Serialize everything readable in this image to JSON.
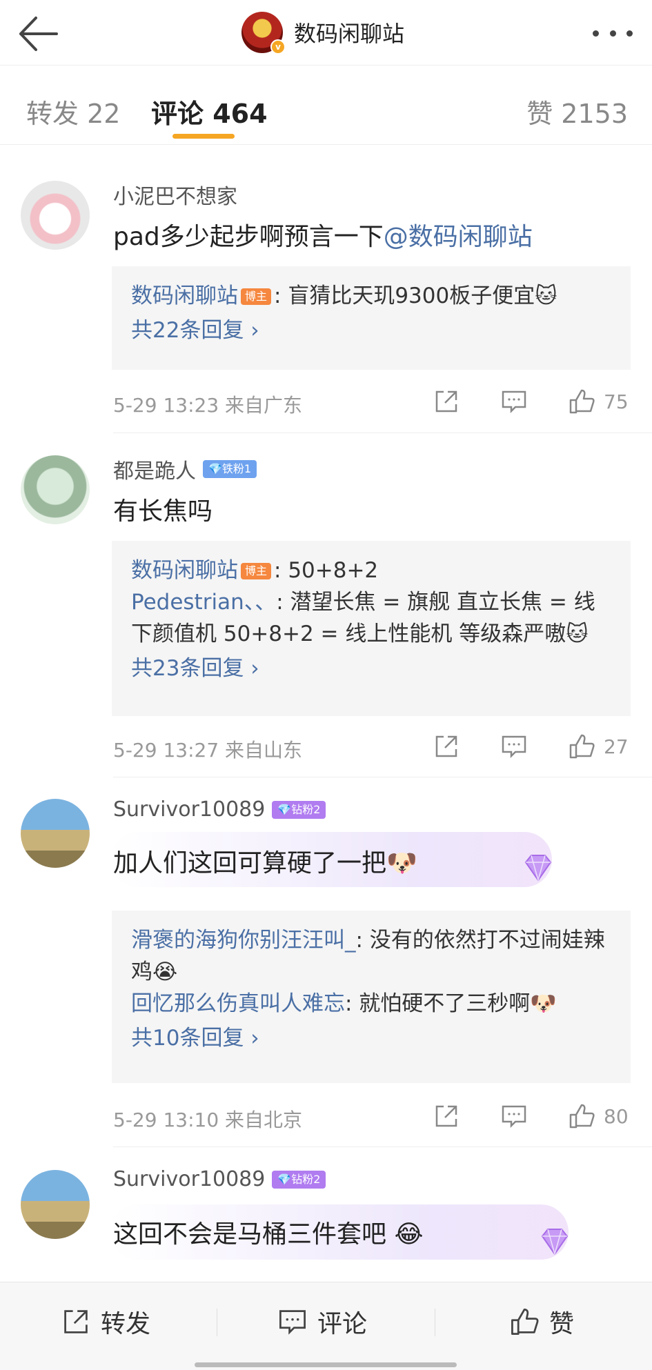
{
  "header": {
    "title": "数码闲聊站"
  },
  "tabs": {
    "repost": "转发 22",
    "comments": "评论 464",
    "likes": "赞 2153"
  },
  "comments": [
    {
      "username": "小泥巴不想家",
      "text": "pad多少起步啊预言一下",
      "mention": "@数码闲聊站",
      "replies": [
        {
          "name": "数码闲聊站",
          "badge": "博主",
          "text": ": 盲猜比天玑9300板子便宜🐱"
        }
      ],
      "more_replies": "共22条回复 ›",
      "time_location": "5-29 13:23  来自广东",
      "likes": "75"
    },
    {
      "username": "都是跪人",
      "badge": "💎铁粉1",
      "text": "有长焦吗",
      "replies": [
        {
          "name": "数码闲聊站",
          "badge": "博主",
          "text": ": 50+8+2"
        },
        {
          "name": "Pedestrian、、",
          "text": ": 潜望长焦 = 旗舰 直立长焦 = 线下颜值机 50+8+2 = 线上性能机 等级森严嗷🐱"
        }
      ],
      "more_replies": "共23条回复 ›",
      "time_location": "5-29 13:27  来自山东",
      "likes": "27"
    },
    {
      "username": "Survivor10089",
      "badge": "💎钻粉2",
      "text": "加人们这回可算硬了一把🐶",
      "replies": [
        {
          "name": "滑褒的海狗你别汪汪叫_",
          "text": ": 没有的依然打不过闹娃辣鸡😭"
        },
        {
          "name": "回忆那么伤真叫人难忘",
          "text": ": 就怕硬不了三秒啊🐶"
        }
      ],
      "more_replies": "共10条回复 ›",
      "time_location": "5-29 13:10  来自北京",
      "likes": "80"
    },
    {
      "username": "Survivor10089",
      "badge": "💎钻粉2",
      "text": "这回不会是马桶三件套吧  😂"
    }
  ],
  "bottom": {
    "repost": "转发",
    "comment": "评论",
    "like": "赞"
  }
}
